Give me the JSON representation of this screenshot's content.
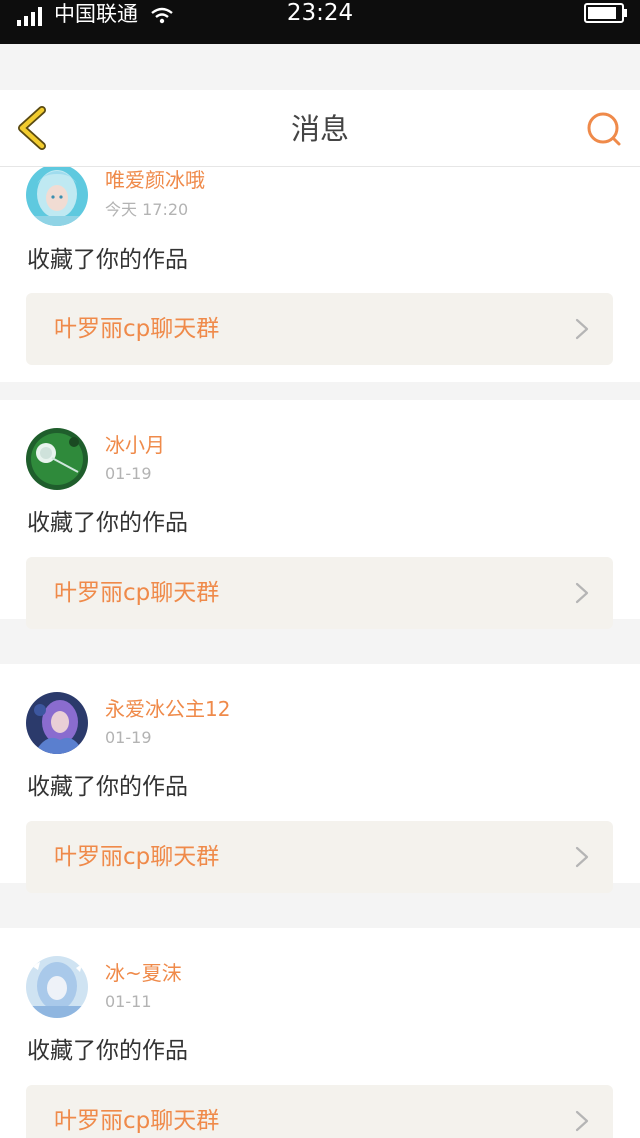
{
  "status_bar": {
    "carrier": "中国联通",
    "time": "23:24"
  },
  "nav": {
    "title": "消息",
    "back_icon": "chevron-left-icon",
    "search_icon": "search-icon"
  },
  "messages": [
    {
      "user": "唯爱颜冰哦",
      "date": "今天 17:20",
      "action": "收藏了你的作品",
      "work": "叶罗丽cp聊天群",
      "avatar": "avatar-1"
    },
    {
      "user": "冰小月",
      "date": "01-19",
      "action": "收藏了你的作品",
      "work": "叶罗丽cp聊天群",
      "avatar": "avatar-2"
    },
    {
      "user": "永爱冰公主12",
      "date": "01-19",
      "action": "收藏了你的作品",
      "work": "叶罗丽cp聊天群",
      "avatar": "avatar-3"
    },
    {
      "user": "冰~夏沫",
      "date": "01-11",
      "action": "收藏了你的作品",
      "work": "叶罗丽cp聊天群",
      "avatar": "avatar-4"
    }
  ],
  "colors": {
    "accent": "#ef8a4a",
    "back_icon": "#e8c22a",
    "card_link_bg": "#f4f2ed",
    "page_bg": "#f4f4f4"
  }
}
